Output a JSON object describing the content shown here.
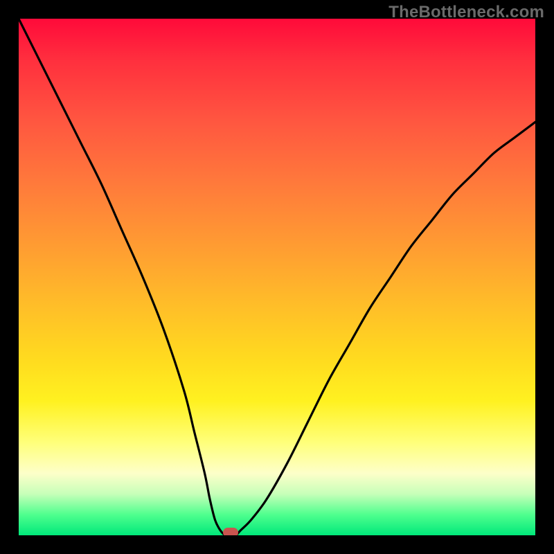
{
  "watermark": "TheBottleneck.com",
  "chart_data": {
    "type": "line",
    "title": "",
    "xlabel": "",
    "ylabel": "",
    "xlim": [
      0,
      100
    ],
    "ylim": [
      0,
      100
    ],
    "grid": false,
    "legend": false,
    "series": [
      {
        "name": "bottleneck-curve",
        "x": [
          0,
          4,
          8,
          12,
          16,
          20,
          24,
          28,
          32,
          34,
          36,
          37,
          38,
          39,
          40,
          41,
          42,
          43,
          45,
          48,
          52,
          56,
          60,
          64,
          68,
          72,
          76,
          80,
          84,
          88,
          92,
          96,
          100
        ],
        "y": [
          100,
          92,
          84,
          76,
          68,
          59,
          50,
          40,
          28,
          20,
          12,
          7,
          3,
          1,
          0,
          0,
          0,
          1,
          3,
          7,
          14,
          22,
          30,
          37,
          44,
          50,
          56,
          61,
          66,
          70,
          74,
          77,
          80
        ]
      }
    ],
    "marker": {
      "x": 41,
      "y": 0.5
    },
    "gradient_stops": [
      {
        "pos": 0,
        "color": "#ff0a3a"
      },
      {
        "pos": 8,
        "color": "#ff2f3e"
      },
      {
        "pos": 20,
        "color": "#ff5740"
      },
      {
        "pos": 32,
        "color": "#ff7a3b"
      },
      {
        "pos": 44,
        "color": "#ff9c32"
      },
      {
        "pos": 56,
        "color": "#ffbf28"
      },
      {
        "pos": 66,
        "color": "#ffdb1f"
      },
      {
        "pos": 74,
        "color": "#fff120"
      },
      {
        "pos": 82,
        "color": "#ffff7a"
      },
      {
        "pos": 88,
        "color": "#fdffc9"
      },
      {
        "pos": 92,
        "color": "#c7ffb9"
      },
      {
        "pos": 96,
        "color": "#4fff8e"
      },
      {
        "pos": 100,
        "color": "#00e87a"
      }
    ]
  }
}
